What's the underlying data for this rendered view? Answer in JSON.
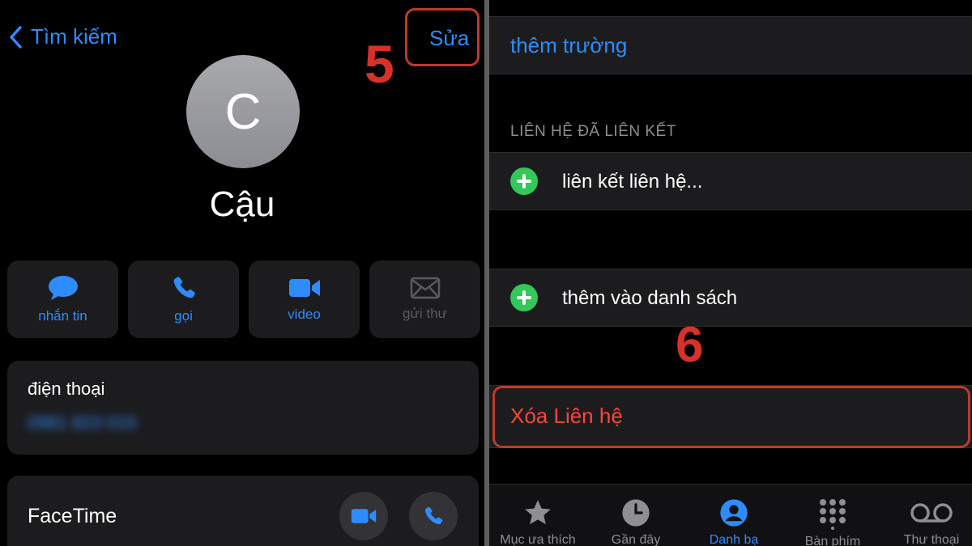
{
  "left": {
    "back_label": "Tìm kiếm",
    "edit_label": "Sửa",
    "step_label": "5",
    "avatar_initial": "C",
    "contact_name": "Cậu",
    "actions": [
      {
        "label": "nhắn tin",
        "icon": "message-icon"
      },
      {
        "label": "gọi",
        "icon": "phone-icon"
      },
      {
        "label": "video",
        "icon": "video-icon"
      },
      {
        "label": "gửi thư",
        "icon": "mail-icon"
      }
    ],
    "phone_card": {
      "title": "điện thoại",
      "number": "0981 823 015"
    },
    "facetime_card": {
      "title": "FaceTime"
    }
  },
  "right": {
    "add_field": "thêm trường",
    "linked_header": "LIÊN HỆ ĐÃ LIÊN KẾT",
    "link_contact": "liên kết liên hệ...",
    "add_to_list": "thêm vào danh sách",
    "step_label": "6",
    "delete_contact": "Xóa Liên hệ",
    "tabs": [
      {
        "label": "Mục ưa thích",
        "icon": "star-icon"
      },
      {
        "label": "Gần đây",
        "icon": "clock-icon"
      },
      {
        "label": "Danh bạ",
        "icon": "person-icon"
      },
      {
        "label": "Bàn phím",
        "icon": "keypad-icon"
      },
      {
        "label": "Thư thoại",
        "icon": "voicemail-icon"
      }
    ]
  },
  "colors": {
    "accent": "#2f8cff",
    "destructive": "#ff453a",
    "highlight": "#d8312a",
    "add_green": "#34c759",
    "card": "#1c1c1e"
  }
}
